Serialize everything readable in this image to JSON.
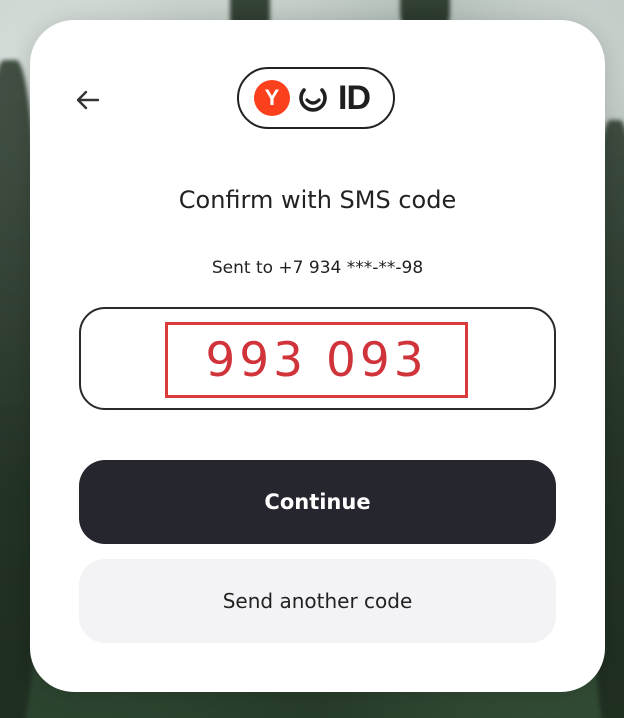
{
  "header": {
    "back_icon": "arrow-left-icon",
    "logo": {
      "y_letter": "Y",
      "id_text": "ID",
      "brand_color": "#fc3f1d"
    }
  },
  "main": {
    "title": "Confirm with SMS code",
    "subtitle": "Sent to +7 934 ***-**-98",
    "code_value": "993 093"
  },
  "actions": {
    "continue_label": "Continue",
    "resend_label": "Send another code"
  },
  "colors": {
    "primary_button": "#26262e",
    "secondary_button": "#f3f3f6",
    "highlight_border": "#d93a3a",
    "code_text": "#d0343a"
  }
}
